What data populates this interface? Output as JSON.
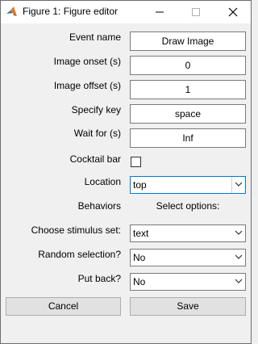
{
  "window": {
    "title": "Figure 1: Figure editor",
    "icon": "matlab-icon",
    "controls": [
      "minimize-icon",
      "maximize-icon",
      "close-icon"
    ]
  },
  "form": {
    "event_name": {
      "label": "Event name",
      "value": "Draw Image"
    },
    "image_onset": {
      "label": "Image onset (s)",
      "value": "0"
    },
    "image_offset": {
      "label": "Image offset (s)",
      "value": "1"
    },
    "specify_key": {
      "label": "Specify key",
      "value": "space"
    },
    "wait_for": {
      "label": "Wait for (s)",
      "value": "Inf"
    },
    "cocktail_bar": {
      "label": "Cocktail bar",
      "checked": false
    },
    "location": {
      "label": "Location",
      "value": "top"
    },
    "behaviors": {
      "label": "Behaviors",
      "note": "Select options:"
    },
    "stimulus_set": {
      "label": "Choose stimulus set:",
      "value": "text"
    },
    "random_selection": {
      "label": "Random selection?",
      "value": "No"
    },
    "put_back": {
      "label": "Put back?",
      "value": "No"
    }
  },
  "buttons": {
    "cancel": "Cancel",
    "save": "Save"
  },
  "colors": {
    "focus": "#0078d7",
    "background": "#f0f0f0"
  }
}
